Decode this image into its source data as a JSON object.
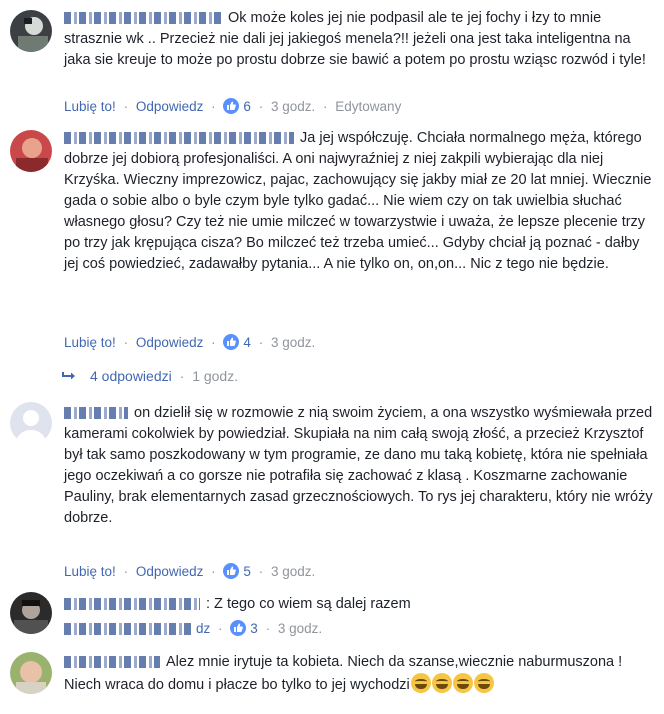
{
  "actions": {
    "like": "Lubię to!",
    "reply": "Odpowiedz",
    "separator": "·"
  },
  "comments": [
    {
      "text": "Ok może koles jej nie podpasil ale te jej fochy i łzy to mnie strasznie wk .. Przecież nie dali jej jakiegoś menela?!! jeżeli ona jest taka inteligentna na jaka sie kreuje to może po prostu dobrze sie bawić a potem po prostu wziąsc rozwód i tyle!",
      "likes": "6",
      "time": "3 godz.",
      "edited": "Edytowany"
    },
    {
      "text": "Ja jej współczuję. Chciała normalnego męża, którego dobrze jej dobiorą profesjonaliści. A oni najwyraźniej z niej zakpili wybierając dla niej Krzyśka. Wieczny imprezowicz, pajac, zachowujący się jakby miał ze 20 lat mniej. Wiecznie gada o sobie albo o byle czym byle tylko gadać... Nie wiem czy on tak uwielbia słuchać własnego głosu? Czy też nie umie milczeć w towarzystwie i uważa, że lepsze plecenie trzy po trzy jak krępująca cisza? Bo milczeć też trzeba umieć... Gdyby chciał ją poznać - dałby jej coś powiedzieć, zadawałby pytania... A nie tylko on, on,on... Nic z tego nie będzie.",
      "likes": "4",
      "time": "3 godz.",
      "replies_label": "4 odpowiedzi",
      "replies_time": "1 godz."
    },
    {
      "text": "on dzielił się w rozmowie z nią swoim życiem, a ona wszystko wyśmiewała przed kamerami cokolwiek by powiedział. Skupiała na nim całą swoją złość, a przecież Krzysztof był tak samo poszkodowany w tym programie, ze dano mu taką kobietę, która nie spełniała jego oczekiwań a co gorsze nie potrafiła się zachować z klasą . Koszmarne zachowanie Pauliny, brak elementarnych zasad grzecznościowych. To rys jej charakteru, który nie wróży dobrze.",
      "likes": "5",
      "time": "3 godz."
    },
    {
      "text": ": Z tego co wiem są dalej razem",
      "name_suffix": "dz",
      "likes": "3",
      "time": "3 godz."
    },
    {
      "text": "Alez mnie irytuje ta kobieta. Niech da szanse,wiecznie naburmuszona ! Niech wraca do domu i płacze bo tylko to jej wychodzi"
    }
  ],
  "colors": {
    "link": "#4267b2",
    "muted": "#90949c",
    "text": "#1d2129",
    "like_badge": "#5890ff"
  },
  "icons": [
    "like-icon",
    "reply-arrow-icon",
    "grin-emoji-icon"
  ]
}
